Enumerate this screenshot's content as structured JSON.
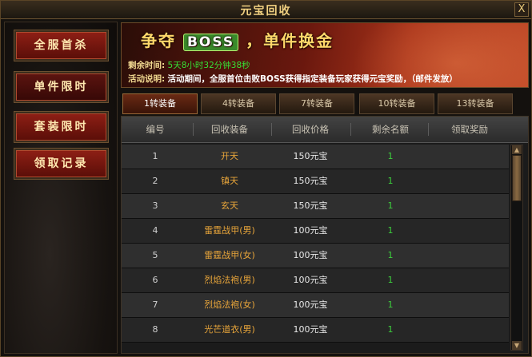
{
  "window": {
    "title": "元宝回收",
    "close_glyph": "X"
  },
  "sidebar": {
    "items": [
      {
        "label": "全服首杀"
      },
      {
        "label": "单件限时"
      },
      {
        "label": "套装限时"
      },
      {
        "label": "领取记录"
      }
    ],
    "active_index": 1
  },
  "banner": {
    "title_pre": "争夺",
    "title_boss": "BOSS",
    "title_post": "，单件换金",
    "time_label": "剩余时间:",
    "time_value": "5天8小时32分钟38秒",
    "desc_label": "活动说明:",
    "desc_value": "活动期间，全服首位击败BOSS获得指定装备玩家获得元宝奖励，（邮件发放）"
  },
  "tabs": [
    {
      "label": "1转装备"
    },
    {
      "label": "4转装备"
    },
    {
      "label": "7转装备"
    },
    {
      "label": "10转装备"
    },
    {
      "label": "13转装备"
    }
  ],
  "active_tab": 0,
  "table": {
    "headers": [
      "编号",
      "回收装备",
      "回收价格",
      "剩余名额",
      "领取奖励"
    ],
    "rows": [
      {
        "num": "1",
        "equip": "开天",
        "price": "150元宝",
        "remain": "1"
      },
      {
        "num": "2",
        "equip": "镇天",
        "price": "150元宝",
        "remain": "1"
      },
      {
        "num": "3",
        "equip": "玄天",
        "price": "150元宝",
        "remain": "1"
      },
      {
        "num": "4",
        "equip": "雷霆战甲(男)",
        "price": "100元宝",
        "remain": "1"
      },
      {
        "num": "5",
        "equip": "雷霆战甲(女)",
        "price": "100元宝",
        "remain": "1"
      },
      {
        "num": "6",
        "equip": "烈焰法袍(男)",
        "price": "100元宝",
        "remain": "1"
      },
      {
        "num": "7",
        "equip": "烈焰法袍(女)",
        "price": "100元宝",
        "remain": "1"
      },
      {
        "num": "8",
        "equip": "光芒道衣(男)",
        "price": "100元宝",
        "remain": "1"
      }
    ]
  },
  "scrollbar": {
    "up_glyph": "▲",
    "down_glyph": "▼"
  },
  "colors": {
    "equip_name": "#e8a53a",
    "remain_count": "#3ccf3c",
    "time_value": "#36e236",
    "title_gold": "#f0d080"
  }
}
